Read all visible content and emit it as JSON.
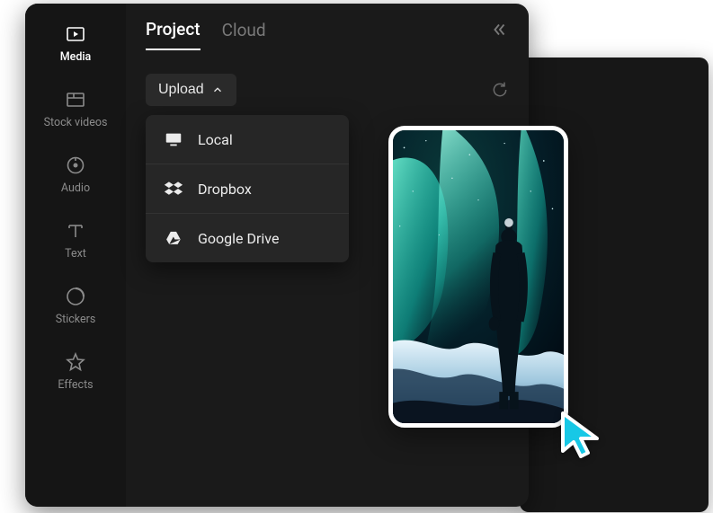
{
  "sidebar": {
    "items": [
      {
        "label": "Media",
        "icon": "media-icon",
        "active": true
      },
      {
        "label": "Stock videos",
        "icon": "stock-videos-icon",
        "active": false
      },
      {
        "label": "Audio",
        "icon": "audio-icon",
        "active": false
      },
      {
        "label": "Text",
        "icon": "text-icon",
        "active": false
      },
      {
        "label": "Stickers",
        "icon": "stickers-icon",
        "active": false
      },
      {
        "label": "Effects",
        "icon": "effects-icon",
        "active": false
      }
    ]
  },
  "tabs": {
    "items": [
      {
        "label": "Project",
        "active": true
      },
      {
        "label": "Cloud",
        "active": false
      }
    ]
  },
  "upload": {
    "button_label": "Upload",
    "menu": [
      {
        "label": "Local",
        "icon": "local-icon"
      },
      {
        "label": "Dropbox",
        "icon": "dropbox-icon"
      },
      {
        "label": "Google Drive",
        "icon": "google-drive-icon"
      }
    ]
  },
  "colors": {
    "bg_app": "#1a1a1a",
    "bg_sidebar": "#151515",
    "accent": "#00bcd4",
    "text_primary": "#ffffff",
    "text_muted": "#8b8b8b"
  },
  "thumbnail": {
    "description": "Portrait photo: silhouette of a person in winter clothing standing on snowy terrain, looking up at green-turquoise aurora borealis in a starry night sky"
  }
}
